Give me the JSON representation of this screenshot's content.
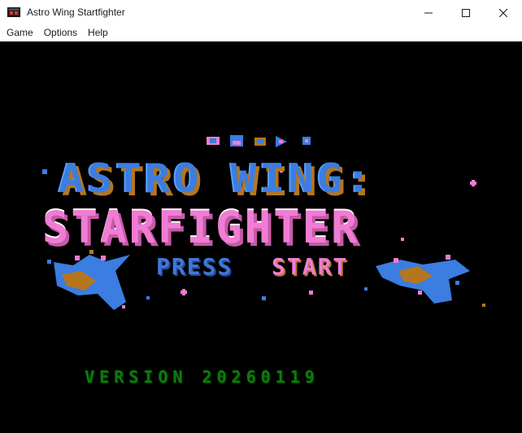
{
  "window": {
    "title": "Astro Wing Startfighter",
    "icon": "app-window-icon",
    "controls": [
      "minimize-icon",
      "maximize-icon",
      "close-icon"
    ]
  },
  "menu": {
    "items": [
      {
        "label": "Game"
      },
      {
        "label": "Options"
      },
      {
        "label": "Help"
      }
    ]
  },
  "game": {
    "title_line1": "ASTRO WING:",
    "title_line2": "STARFIGHTER",
    "press": "PRESS",
    "start": "START",
    "version": "VERSION 20260119",
    "colors": {
      "background": "#000000",
      "title_blue": "#3b7de0",
      "title_orange": "#b5761e",
      "title_pink": "#f07cd4",
      "version_green": "#0b7a0b"
    }
  }
}
